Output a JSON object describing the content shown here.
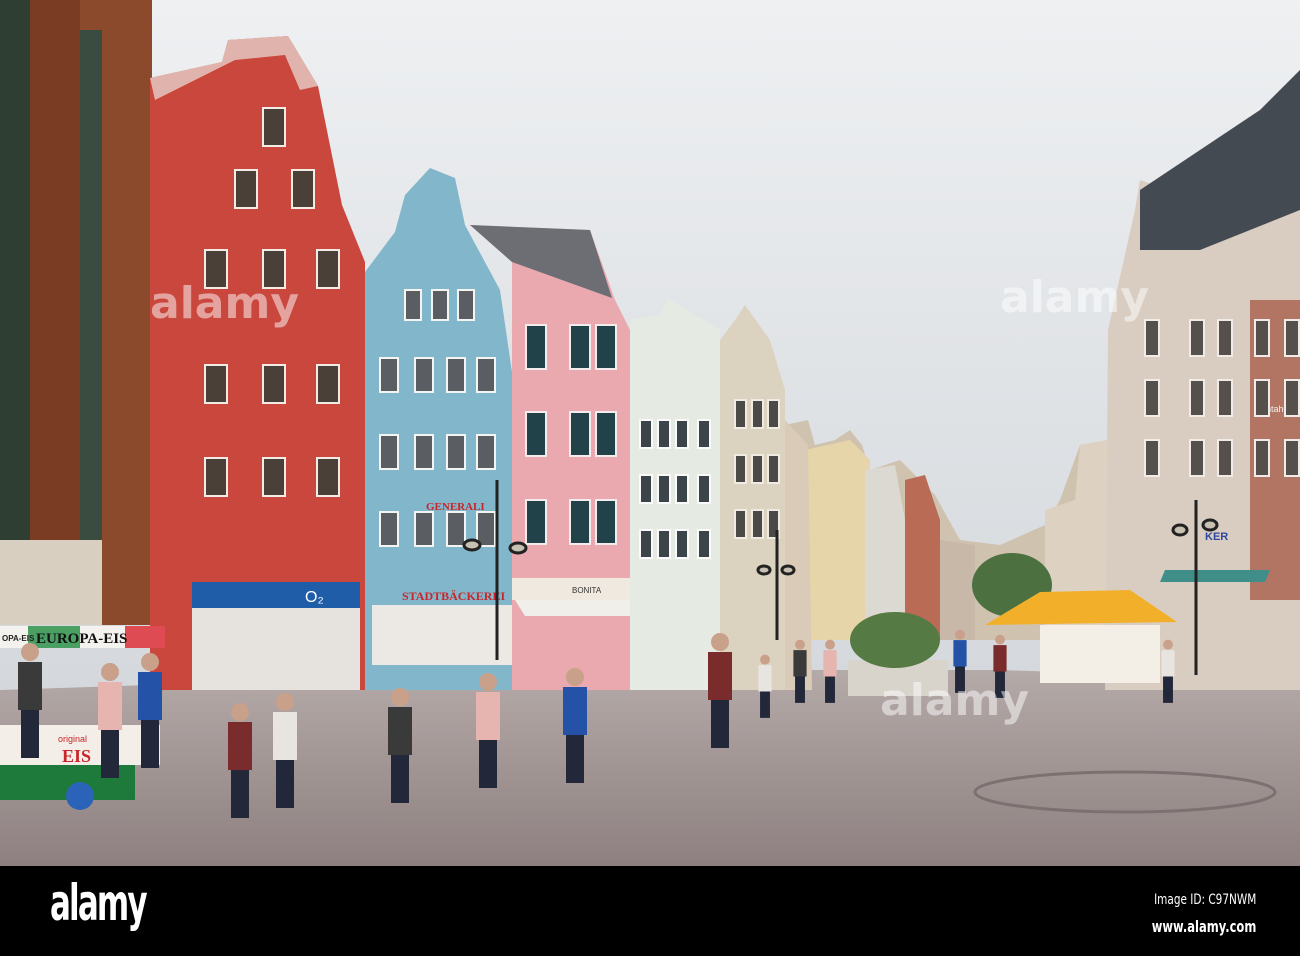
{
  "photo": {
    "signs": {
      "europa_eis": "EUROPA-EIS",
      "europa_eis_side": "OPA-EIS",
      "cart_original": "original",
      "cart_eis": "EIS",
      "o2": "O₂",
      "generali": "GENERALI",
      "stadtbaeckerei": "STADTBÄCKEREI",
      "bonita": "BONITA",
      "pentahotel": "pentahotel",
      "store_right": "KER"
    },
    "watermark": "alamy",
    "colors": {
      "sky": "#e2e5e8",
      "red_house": "#c9473d",
      "blue_house": "#82b6cb",
      "pink_house": "#eaa9ae",
      "white_house": "#e5ebe3",
      "umbrella": "#f2b02a",
      "pavement": "#9c8f8f"
    }
  },
  "footer": {
    "logo": "alamy",
    "image_id": "Image ID: C97NWM",
    "url": "www.alamy.com"
  }
}
